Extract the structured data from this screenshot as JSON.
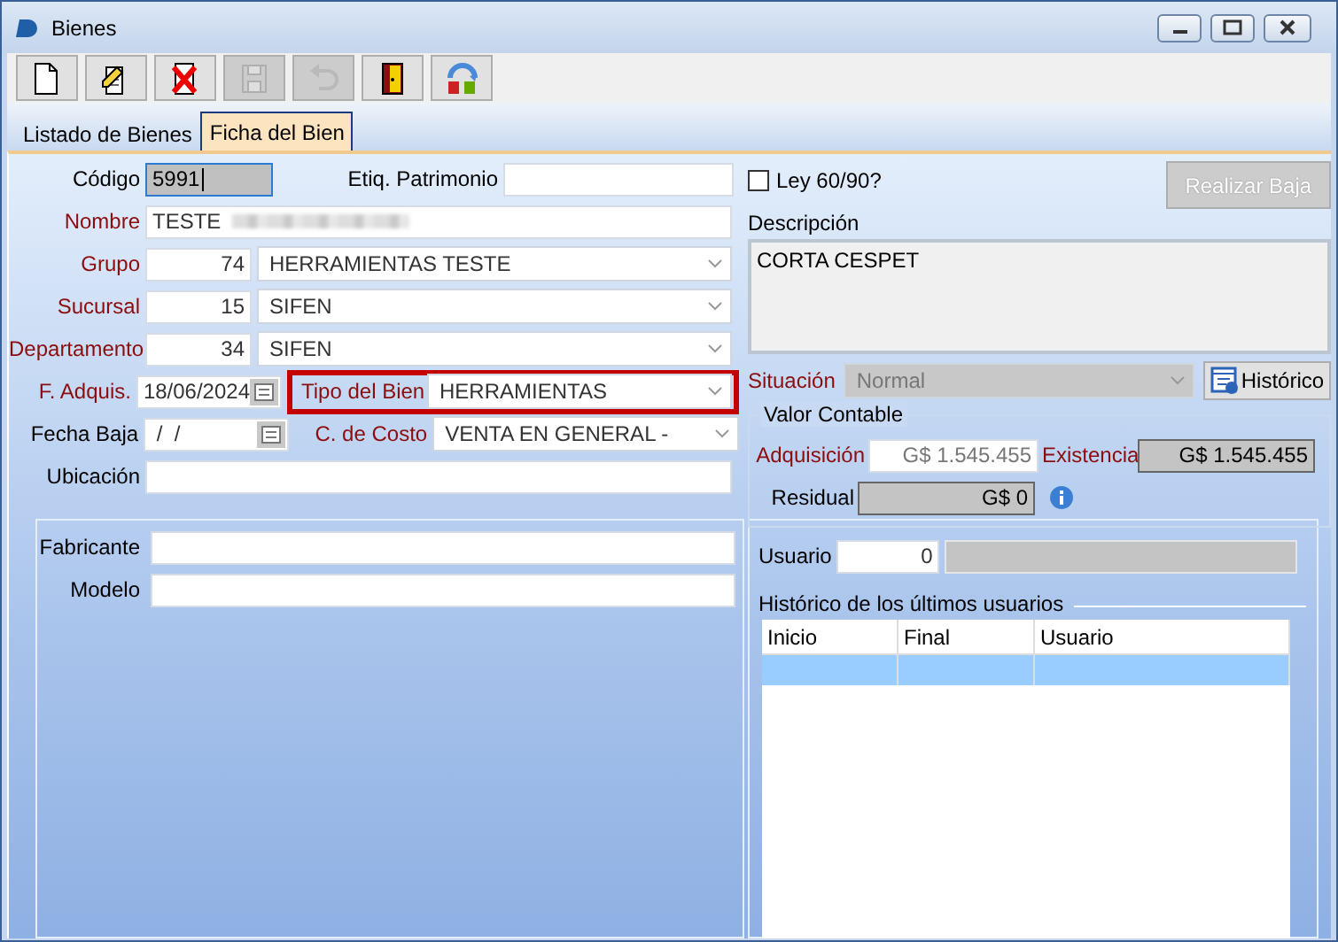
{
  "window": {
    "title": "Bienes"
  },
  "toolbar": [
    {
      "kind": "new",
      "disabled": false
    },
    {
      "kind": "edit",
      "disabled": false
    },
    {
      "kind": "delete",
      "disabled": false
    },
    {
      "kind": "save",
      "disabled": true
    },
    {
      "kind": "undo",
      "disabled": true
    },
    {
      "kind": "exit",
      "disabled": false
    },
    {
      "kind": "swap",
      "disabled": false
    }
  ],
  "tabs": [
    {
      "label": "Listado de Bienes",
      "selected": false
    },
    {
      "label": "Ficha del Bien",
      "selected": true
    }
  ],
  "fields": {
    "codigo": {
      "label": "Código",
      "value": "5991",
      "required": false,
      "focused": true
    },
    "etiq_patrimonio": {
      "label": "Etiq. Patrimonio",
      "required": false
    },
    "nombre": {
      "label": "Nombre",
      "value": "TESTE",
      "required": true,
      "redacted": true
    },
    "grupo": {
      "label": "Grupo",
      "code": "74",
      "value": "HERRAMIENTAS TESTE",
      "required": true
    },
    "sucursal": {
      "label": "Sucursal",
      "code": "15",
      "value": "SIFEN",
      "required": true
    },
    "departamento": {
      "label": "Departamento",
      "code": "34",
      "value": "SIFEN",
      "required": true
    },
    "f_adquis": {
      "label": "F. Adquis.",
      "value": "18/06/2024",
      "required": true
    },
    "tipo_del_bien": {
      "label": "Tipo del Bien",
      "value": "HERRAMIENTAS",
      "required": true,
      "highlighted": true
    },
    "fecha_baja": {
      "label": "Fecha Baja",
      "value": " /  /",
      "required": false
    },
    "c_de_costo": {
      "label": "C. de Costo",
      "value": "VENTA EN GENERAL -",
      "required": true
    },
    "ubicacion": {
      "label": "Ubicación",
      "required": false
    }
  },
  "right": {
    "ley_60_90": {
      "label": "Ley 60/90?",
      "checked": false
    },
    "realizar_baja": {
      "label": "Realizar Baja",
      "disabled": true
    },
    "descripcion": {
      "label": "Descripción",
      "value": "CORTA CESPET"
    },
    "situacion": {
      "label": "Situación",
      "value": "Normal",
      "required": true,
      "disabled": true
    },
    "historico": {
      "label": "Histórico"
    },
    "valor_contable": {
      "title": "Valor Contable",
      "adquisicion": {
        "label": "Adquisición",
        "value": "G$ 1.545.455",
        "required": true
      },
      "existencia": {
        "label": "Existencia",
        "value": "G$ 1.545.455",
        "required": true
      },
      "residual": {
        "label": "Residual",
        "value": "G$ 0",
        "required": false
      }
    }
  },
  "bottom": {
    "fabricante": {
      "label": "Fabricante"
    },
    "modelo": {
      "label": "Modelo"
    },
    "usuario": {
      "label": "Usuario",
      "value": "0"
    },
    "historial": {
      "title": "Histórico de los últimos usuarios",
      "columns": [
        "Inicio",
        "Final",
        "Usuario"
      ],
      "rows": [
        {
          "selected": true
        }
      ]
    }
  }
}
